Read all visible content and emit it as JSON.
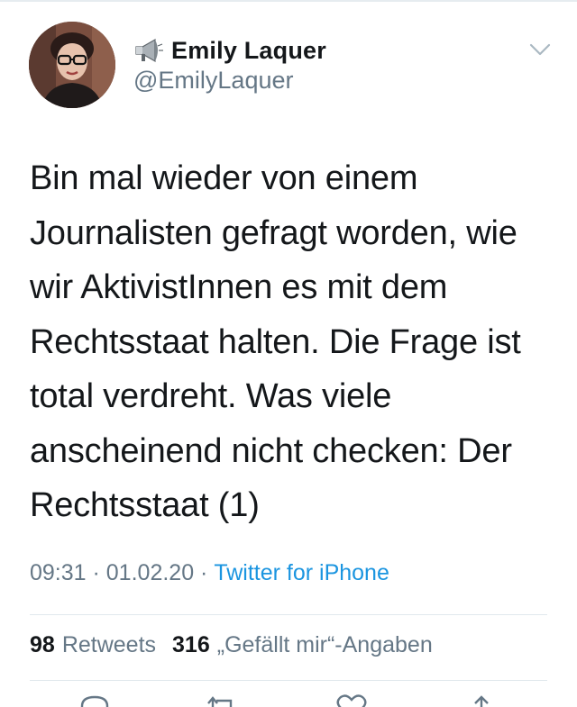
{
  "author": {
    "display_name": "Emily Laquer",
    "handle": "@EmilyLaquer"
  },
  "tweet": {
    "text": "Bin mal wieder von einem\nJournalisten gefragt worden, wie\nwir AktivistInnen es mit dem\nRechtsstaat halten. Die Frage ist\ntotal verdreht. Was viele\nanscheinend nicht checken: Der\nRechtsstaat (1)",
    "time": "09:31",
    "date": "01.02.20",
    "dot1": " · ",
    "dot2": " · ",
    "source": "Twitter for iPhone"
  },
  "stats": {
    "retweets_count": "98",
    "retweets_label": "Retweets",
    "likes_count": "316",
    "likes_label": "„Gefällt mir“-Angaben"
  },
  "icons": {
    "megaphone": "megaphone-icon",
    "chevron": "chevron-down-icon",
    "reply": "reply-icon",
    "retweet": "retweet-icon",
    "like": "heart-icon",
    "share": "share-icon"
  },
  "colors": {
    "text": "#14171a",
    "secondary": "#657786",
    "link": "#1b95e0",
    "divider": "#e1e8ed"
  }
}
